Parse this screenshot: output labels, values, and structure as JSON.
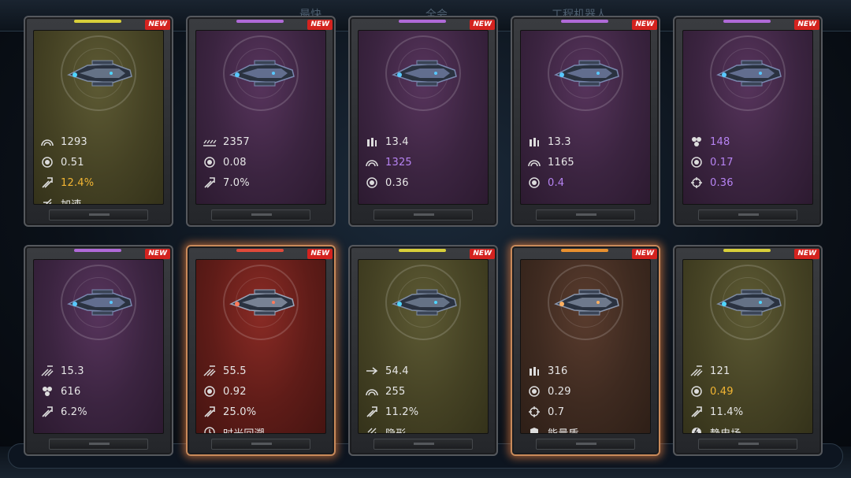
{
  "background": {
    "top_tabs": [
      "最快",
      "全会",
      "工程机器人"
    ]
  },
  "colors": {
    "purple": "#b06ad8",
    "olive": "#d8cf3a",
    "red": "#e04a3a",
    "orange": "#e8902f",
    "new_badge": "#d4231f",
    "gold_value": "#f2b533",
    "violet_value": "#b683f2"
  },
  "cards": [
    {
      "theme": "olive",
      "new": "NEW",
      "top_color": "#d8cf3a",
      "ship_icon": "ship-icon",
      "stats": [
        {
          "icon": "armor-icon",
          "value": "1293",
          "tone": ""
        },
        {
          "icon": "energy-icon",
          "value": "0.51",
          "tone": ""
        },
        {
          "icon": "crit-icon",
          "value": "12.4%",
          "tone": "gold"
        },
        {
          "icon": "boost-icon",
          "value": "加速",
          "tone": ""
        }
      ]
    },
    {
      "theme": "purple",
      "new": "NEW",
      "top_color": "#b06ad8",
      "ship_icon": "ship-icon",
      "stats": [
        {
          "icon": "spread-icon",
          "value": "2357",
          "tone": ""
        },
        {
          "icon": "energy-icon",
          "value": "0.08",
          "tone": ""
        },
        {
          "icon": "crit-icon",
          "value": "7.0%",
          "tone": ""
        }
      ]
    },
    {
      "theme": "purple",
      "new": "NEW",
      "top_color": "#b06ad8",
      "ship_icon": "ship-icon",
      "stats": [
        {
          "icon": "ammo-icon",
          "value": "13.4",
          "tone": ""
        },
        {
          "icon": "armor-icon",
          "value": "1325",
          "tone": "violet"
        },
        {
          "icon": "energy-icon",
          "value": "0.36",
          "tone": ""
        }
      ]
    },
    {
      "theme": "purple",
      "new": "NEW",
      "top_color": "#b06ad8",
      "ship_icon": "ship-icon",
      "stats": [
        {
          "icon": "ammo-icon",
          "value": "13.3",
          "tone": ""
        },
        {
          "icon": "armor-icon",
          "value": "1165",
          "tone": ""
        },
        {
          "icon": "energy-icon",
          "value": "0.4",
          "tone": "violet"
        }
      ]
    },
    {
      "theme": "purple",
      "new": "NEW",
      "top_color": "#b06ad8",
      "ship_icon": "ship-icon",
      "stats": [
        {
          "icon": "cluster-icon",
          "value": "148",
          "tone": "violet"
        },
        {
          "icon": "energy-icon",
          "value": "0.17",
          "tone": "violet"
        },
        {
          "icon": "crosshair-icon",
          "value": "0.36",
          "tone": "violet"
        }
      ]
    },
    {
      "theme": "purple",
      "new": "NEW",
      "top_color": "#b06ad8",
      "ship_icon": "ship-icon",
      "stats": [
        {
          "icon": "fire-rate-icon",
          "value": "15.3",
          "tone": ""
        },
        {
          "icon": "cluster-icon",
          "value": "616",
          "tone": ""
        },
        {
          "icon": "crit-icon",
          "value": "6.2%",
          "tone": ""
        }
      ]
    },
    {
      "theme": "red",
      "new": "NEW",
      "top_color": "#e04a3a",
      "glow": true,
      "ship_icon": "ship-icon",
      "stats": [
        {
          "icon": "fire-rate-icon",
          "value": "55.5",
          "tone": ""
        },
        {
          "icon": "energy-icon",
          "value": "0.92",
          "tone": ""
        },
        {
          "icon": "crit-icon",
          "value": "25.0%",
          "tone": ""
        },
        {
          "icon": "rewind-icon",
          "value": "时光回溯",
          "tone": ""
        }
      ]
    },
    {
      "theme": "olive",
      "new": "NEW",
      "top_color": "#d8cf3a",
      "ship_icon": "ship-icon",
      "stats": [
        {
          "icon": "speed-icon",
          "value": "54.4",
          "tone": ""
        },
        {
          "icon": "armor-icon",
          "value": "255",
          "tone": ""
        },
        {
          "icon": "crit-icon",
          "value": "11.2%",
          "tone": ""
        },
        {
          "icon": "stealth-icon",
          "value": "隐形",
          "tone": ""
        }
      ]
    },
    {
      "theme": "orange",
      "new": "NEW",
      "top_color": "#e8902f",
      "glow": true,
      "ship_icon": "ship-icon",
      "stats": [
        {
          "icon": "ammo-icon",
          "value": "316",
          "tone": ""
        },
        {
          "icon": "energy-icon",
          "value": "0.29",
          "tone": ""
        },
        {
          "icon": "crosshair-icon",
          "value": "0.7",
          "tone": ""
        },
        {
          "icon": "shield-icon",
          "value": "能量盾",
          "tone": ""
        }
      ]
    },
    {
      "theme": "olive",
      "new": "NEW",
      "top_color": "#d8cf3a",
      "ship_icon": "ship-icon",
      "stats": [
        {
          "icon": "fire-rate-icon",
          "value": "121",
          "tone": ""
        },
        {
          "icon": "energy-icon",
          "value": "0.49",
          "tone": "gold"
        },
        {
          "icon": "crit-icon",
          "value": "11.4%",
          "tone": ""
        },
        {
          "icon": "static-field-icon",
          "value": "静电场",
          "tone": ""
        }
      ]
    }
  ]
}
